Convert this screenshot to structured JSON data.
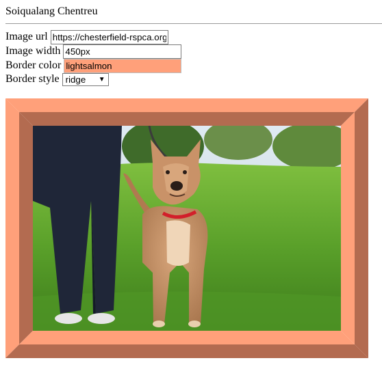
{
  "page": {
    "title": "Soiqualang Chentreu"
  },
  "form": {
    "image_url": {
      "label": "Image url",
      "value": "https://chesterfield-rspca.org"
    },
    "image_width": {
      "label": "Image width",
      "value": "450px"
    },
    "border_color": {
      "label": "Border color",
      "value": "lightsalmon"
    },
    "border_style": {
      "label": "Border style",
      "value": "ridge"
    }
  },
  "image": {
    "subject": "dog-on-grass-photo"
  },
  "colors": {
    "border_light": "#ffa07a",
    "border_dark": "#b36b50",
    "accent_color_field": "#ffa07a"
  }
}
